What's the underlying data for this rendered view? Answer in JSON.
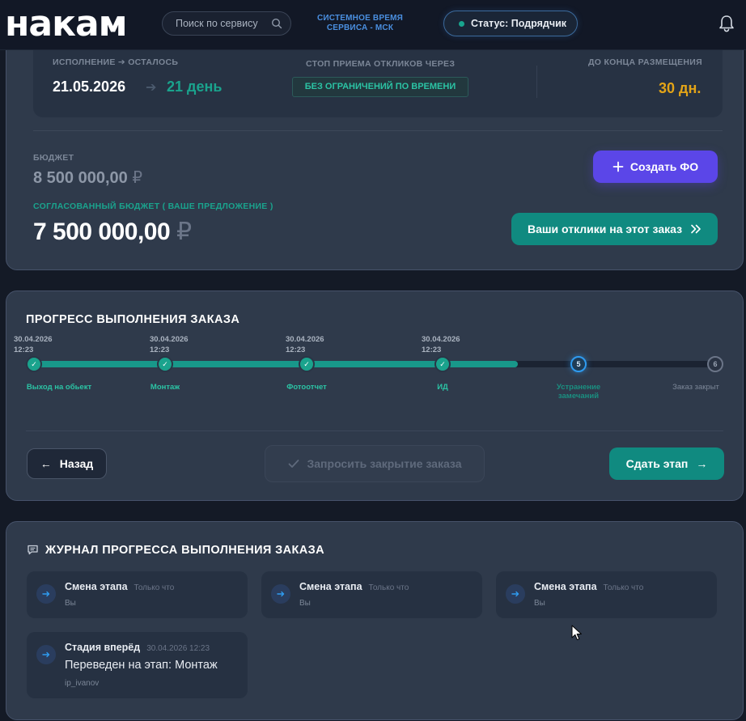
{
  "header": {
    "logo": "накам",
    "search_placeholder": "Поиск по сервису",
    "system_time_line1": "СИСТЕМНОЕ ВРЕМЯ",
    "system_time_line2": "СЕРВИСА - МСК",
    "status": "Статус: Подрядчик",
    "colors": {
      "accent": "#1aa38d",
      "link": "#4a8fe0",
      "status_dot": "#18a58e"
    }
  },
  "order_summary": {
    "execution_label": "ИСПОЛНЕНИЕ ➔ ОСТАЛОСЬ",
    "execution_date": "21.05.2026",
    "days_left": "21 день",
    "stop_label": "СТОП ПРИЕМА ОТКЛИКОВ ЧЕРЕЗ",
    "stop_value": "БЕЗ ОГРАНИЧЕНИЙ ПО ВРЕМЕНИ",
    "placement_label": "ДО КОНЦА РАЗМЕЩЕНИЯ",
    "placement_value": "30 дн.",
    "budget_label": "БЮДЖЕТ",
    "budget_value": "8 500 000,00",
    "agreed_label": "СОГЛАСОВАННЫЙ БЮДЖЕТ ( ВАШЕ ПРЕДЛОЖЕНИЕ )",
    "agreed_value": "7 500 000,00",
    "currency": "₽",
    "create_fo_button": "Создать ФО",
    "responses_button": "Ваши отклики на этот заказ"
  },
  "progress": {
    "title": "ПРОГРЕСС ВЫПОЛНЕНИЯ ЗАКАЗА",
    "filled_fraction": 0.71,
    "stages": [
      {
        "date": "30.04.2026",
        "time": "12:23",
        "label": "Выход на обьект",
        "state": "done",
        "mark": "✓"
      },
      {
        "date": "30.04.2026",
        "time": "12:23",
        "label": "Монтаж",
        "state": "done",
        "mark": "✓"
      },
      {
        "date": "30.04.2026",
        "time": "12:23",
        "label": "Фотоотчет",
        "state": "done",
        "mark": "✓"
      },
      {
        "date": "30.04.2026",
        "time": "12:23",
        "label": "ИД",
        "state": "done",
        "mark": "✓"
      },
      {
        "date": "",
        "time": "",
        "label_line1": "Устранение",
        "label_line2": "замечаний",
        "state": "current",
        "mark": "5"
      },
      {
        "date": "",
        "time": "",
        "label": "Заказ закрыт",
        "state": "future",
        "mark": "6"
      }
    ],
    "back_button": "Назад",
    "request_close_button": "Запросить закрытие заказа",
    "submit_stage_button": "Сдать этап"
  },
  "journal": {
    "title": "ЖУРНАЛ ПРОГРЕССА ВЫПОЛНЕНИЯ ЗАКАЗА",
    "entries": [
      {
        "title": "Смена этапа",
        "time": "Только что",
        "author": "Вы"
      },
      {
        "title": "Смена этапа",
        "time": "Только что",
        "author": "Вы"
      },
      {
        "title": "Смена этапа",
        "time": "Только что",
        "author": "Вы"
      },
      {
        "title": "Стадия вперёд",
        "time": "30.04.2026 12:23",
        "message": "Переведен на этап: Монтаж",
        "author": "ip_ivanov"
      }
    ]
  }
}
